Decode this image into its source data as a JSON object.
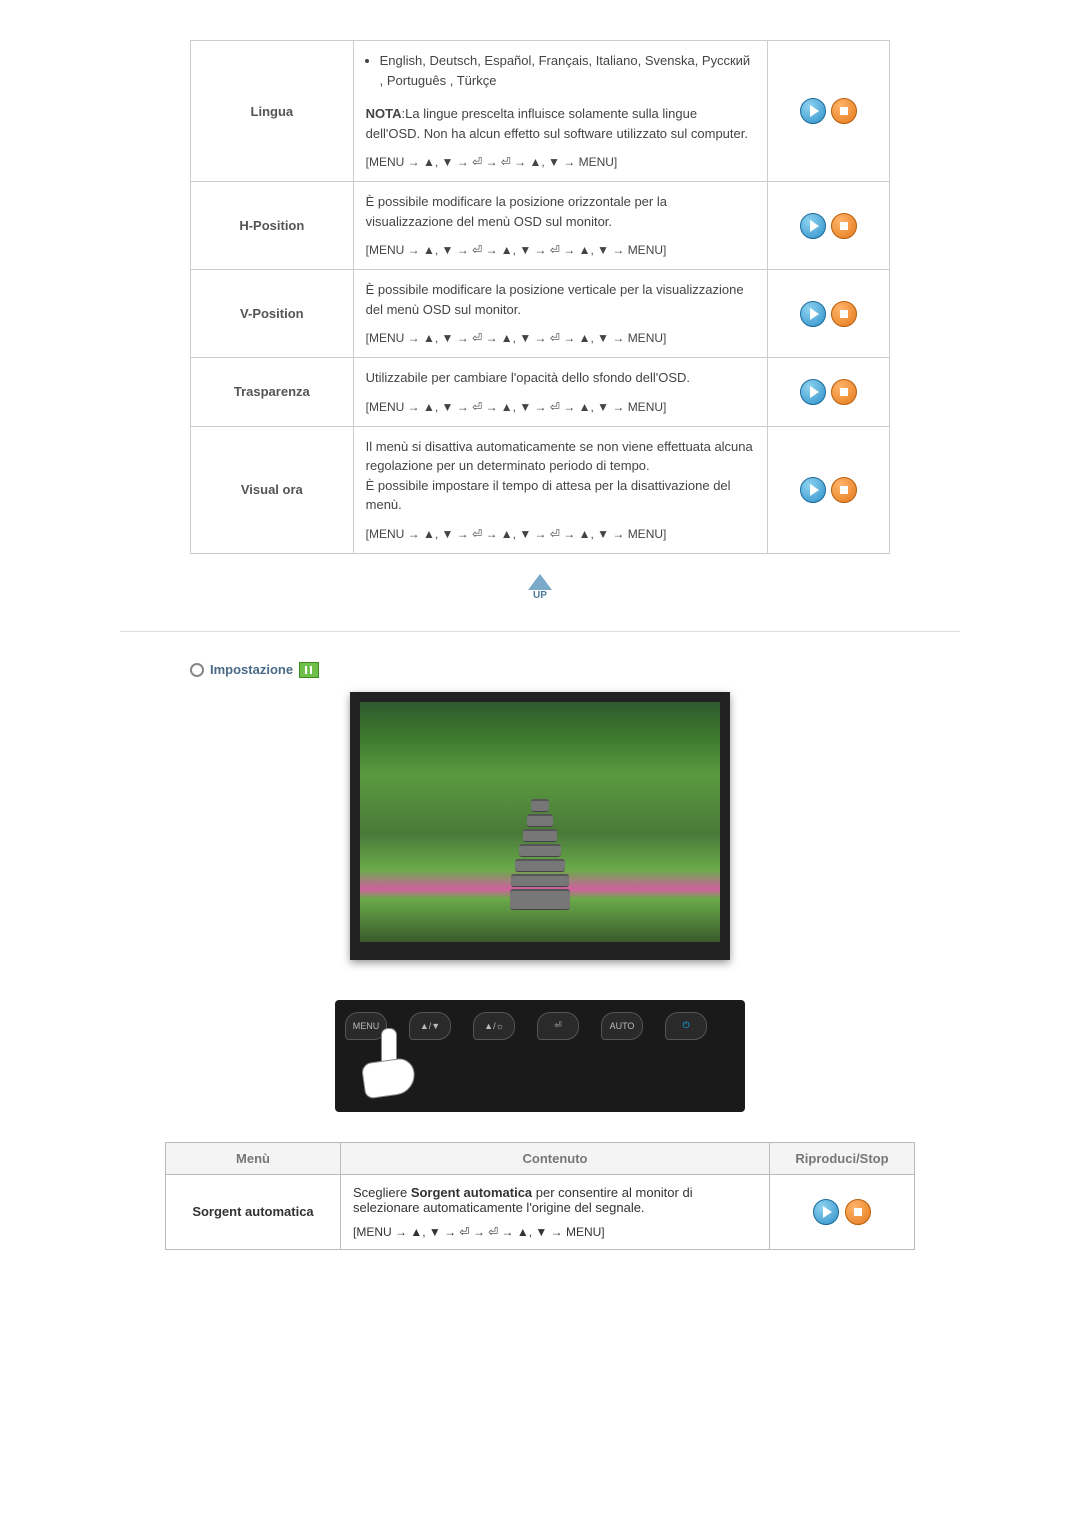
{
  "osd_rows": [
    {
      "menu": "Lingua",
      "languages": "English, Deutsch, Español, Français,  Italiano, Svenska, Русский , Português , Türkçe",
      "note_label": "NOTA",
      "note_text": ":La lingue prescelta influisce solamente sulla lingue dell'OSD. Non ha alcun effetto sul software utilizzato sul computer.",
      "sequence": "[MENU → ▲, ▼ → ⏎ → ⏎ → ▲, ▼ → MENU]"
    },
    {
      "menu": "H-Position",
      "desc": "È possibile modificare la posizione orizzontale per la visualizzazione del menù OSD sul monitor.",
      "sequence": "[MENU → ▲, ▼ → ⏎ → ▲, ▼ → ⏎ → ▲, ▼ → MENU]"
    },
    {
      "menu": "V-Position",
      "desc": "È possibile modificare la posizione verticale per la visualizzazione del menù OSD sul monitor.",
      "sequence": "[MENU → ▲, ▼ → ⏎ → ▲, ▼ → ⏎ → ▲, ▼ → MENU]"
    },
    {
      "menu": "Trasparenza",
      "desc": "Utilizzabile per cambiare l'opacità dello sfondo dell'OSD.",
      "sequence": "[MENU → ▲, ▼ → ⏎ → ▲, ▼ → ⏎ → ▲, ▼ → MENU]"
    },
    {
      "menu": "Visual ora",
      "desc": "Il menù si disattiva automaticamente se non viene effettuata alcuna regolazione per un determinato periodo di tempo.\nÈ possibile impostare il tempo di attesa per la disattivazione del menù.",
      "sequence": "[MENU → ▲, ▼ → ⏎ → ▲, ▼ → ⏎ → ▲, ▼ → MENU]"
    }
  ],
  "up_label": "UP",
  "section2_title": "Impostazione",
  "ctrl_labels": {
    "menu": "MENU",
    "updown": "▲/▼",
    "bright": "▲/☼",
    "enter": "⏎",
    "auto": "AUTO",
    "power": "⏻"
  },
  "table2": {
    "headers": {
      "menu": "Menù",
      "content": "Contenuto",
      "play": "Riproduci/Stop"
    },
    "row": {
      "menu": "Sorgent automatica",
      "pre": "Scegliere ",
      "bold": "Sorgent automatica",
      "post": " per consentire al monitor di selezionare automaticamente l'origine del segnale.",
      "sequence": "[MENU → ▲, ▼ → ⏎ → ⏎ → ▲, ▼ → MENU]"
    }
  }
}
